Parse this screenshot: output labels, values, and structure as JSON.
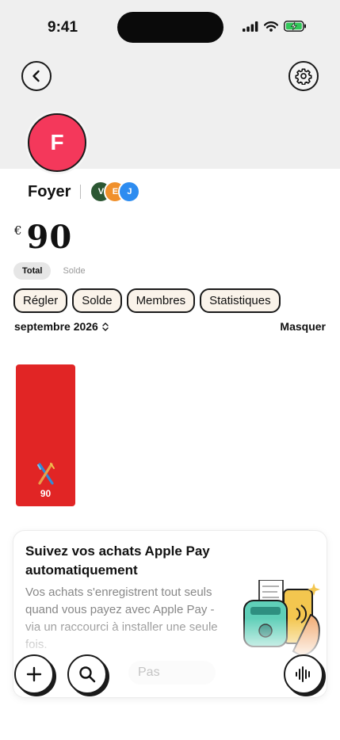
{
  "status_bar": {
    "time": "9:41"
  },
  "group": {
    "avatar_letter": "F",
    "name": "Foyer",
    "members": [
      {
        "initial": "V",
        "color": "#2c5733"
      },
      {
        "initial": "E",
        "color": "#f0902c"
      },
      {
        "initial": "J",
        "color": "#2d8cf0"
      }
    ]
  },
  "balance": {
    "currency": "€",
    "amount": "90"
  },
  "view_toggle": {
    "active": "Total",
    "inactive": "Solde"
  },
  "actions": [
    "Régler",
    "Solde",
    "Membres",
    "Statistiques"
  ],
  "period": {
    "label": "septembre 2026",
    "hide_label": "Masquer"
  },
  "chart_data": {
    "type": "bar",
    "categories": [
      "restaurant"
    ],
    "values": [
      90
    ],
    "title": "",
    "xlabel": "",
    "ylabel": ""
  },
  "promo": {
    "title": "Suivez vos achats Apple Pay automatiquement",
    "body": "Vos achats s'enregistrent tout seuls quand vous payez avec Apple Pay - via un raccourci à installer une seule fois.",
    "skip_label": "Pas"
  },
  "colors": {
    "accent_red": "#e12525",
    "avatar_pink": "#f4385b",
    "chip_bg": "#faf3ea"
  }
}
